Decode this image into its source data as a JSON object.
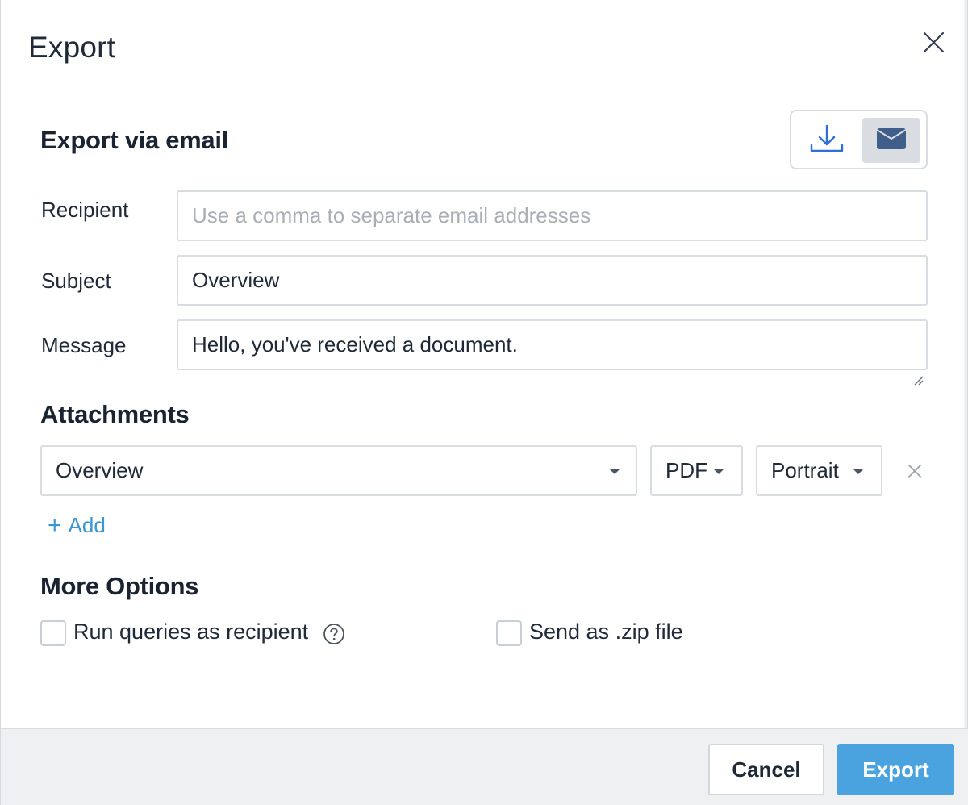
{
  "dialog": {
    "title": "Export"
  },
  "email_section": {
    "heading": "Export via email",
    "mode_selected": "email"
  },
  "form": {
    "recipient": {
      "label": "Recipient",
      "value": "",
      "placeholder": "Use a comma to separate email addresses"
    },
    "subject": {
      "label": "Subject",
      "value": "Overview"
    },
    "message": {
      "label": "Message",
      "value": "Hello, you've received a document."
    }
  },
  "attachments": {
    "heading": "Attachments",
    "items": [
      {
        "dashboard": "Overview",
        "format": "PDF",
        "orientation": "Portrait"
      }
    ],
    "add_label": "Add"
  },
  "more_options": {
    "heading": "More Options",
    "run_as_recipient": {
      "label": "Run queries as recipient",
      "checked": false
    },
    "send_as_zip": {
      "label": "Send as .zip file",
      "checked": false
    }
  },
  "footer": {
    "cancel_label": "Cancel",
    "export_label": "Export"
  },
  "colors": {
    "accent": "#4aa3df",
    "link": "#3b97d3",
    "toggle_active_bg": "#d9dce0",
    "email_icon": "#3f5f8a",
    "download_icon": "#2f6fd6"
  }
}
